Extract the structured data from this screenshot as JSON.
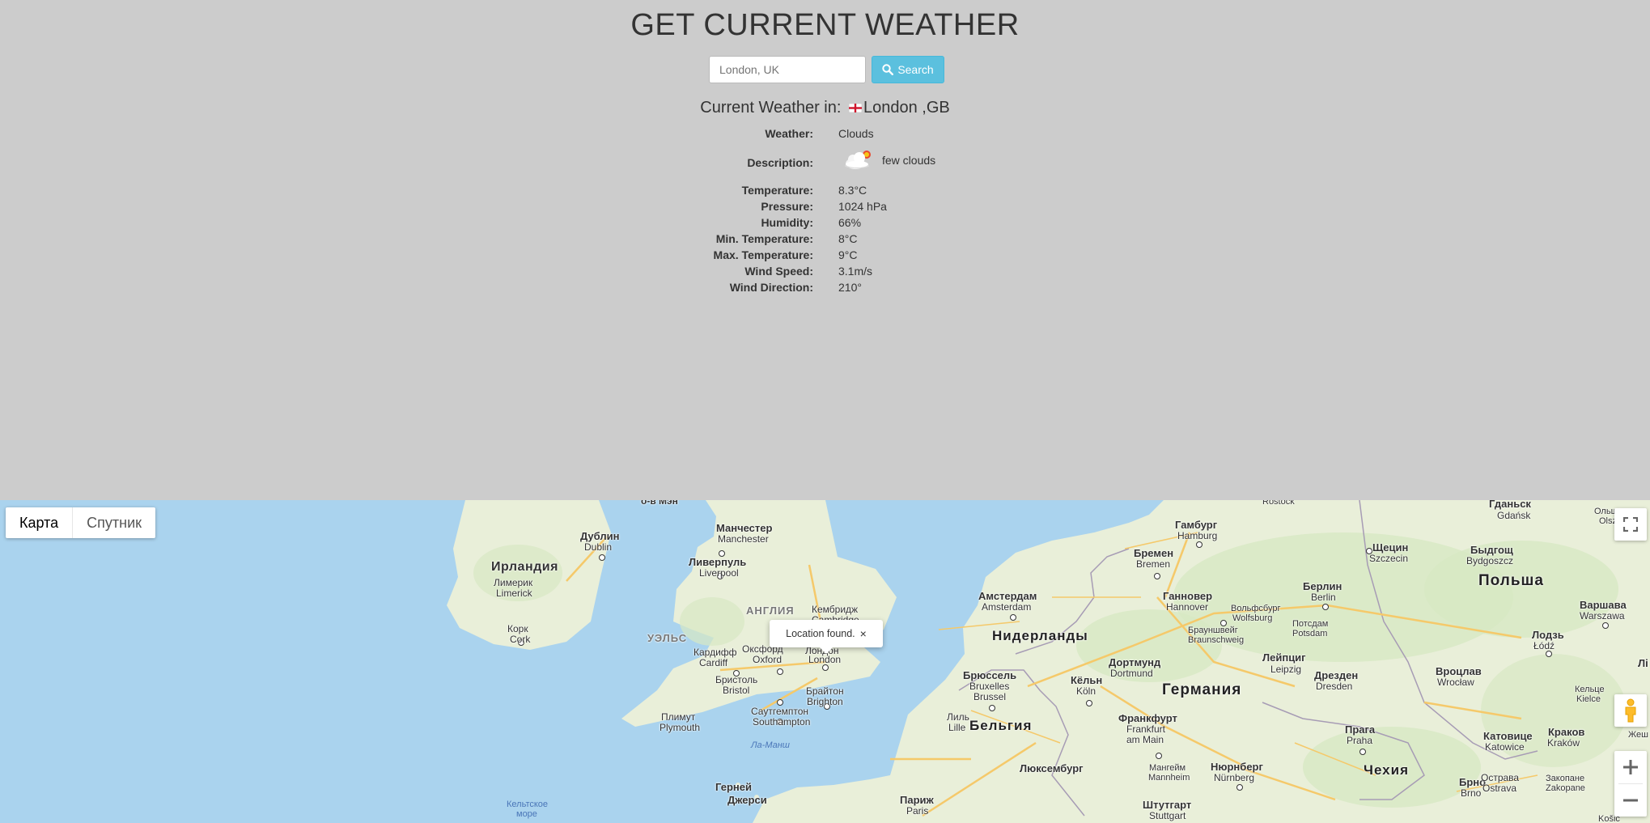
{
  "page": {
    "title": "GET CURRENT WEATHER",
    "search": {
      "placeholder": "London, UK",
      "value": "",
      "button_label": "Search"
    },
    "current": {
      "prefix": "Current Weather in:",
      "location": "London ,GB"
    },
    "weather": {
      "weather_label": "Weather:",
      "weather_value": "Clouds",
      "description_label": "Description:",
      "description_value": "few clouds",
      "temperature_label": "Temperature:",
      "temperature_value": "8.3°C",
      "pressure_label": "Pressure:",
      "pressure_value": "1024 hPa",
      "humidity_label": "Humidity:",
      "humidity_value": "66%",
      "min_temp_label": "Min. Temperature:",
      "min_temp_value": "8°C",
      "max_temp_label": "Max. Temperature:",
      "max_temp_value": "9°C",
      "wind_speed_label": "Wind Speed:",
      "wind_speed_value": "3.1m/s",
      "wind_dir_label": "Wind Direction:",
      "wind_dir_value": "210°"
    }
  },
  "map": {
    "map_type": {
      "map_label": "Карта",
      "satellite_label": "Спутник",
      "selected": "Карта"
    },
    "popup": {
      "text": "Location found.",
      "close": "×"
    },
    "labels": {
      "isle_man": "о-в Мэн",
      "manchester_ru": "Манчестер",
      "manchester": "Manchester",
      "dublin_ru": "Дублин",
      "dublin": "Dublin",
      "liverpool_ru": "Ливерпуль",
      "liverpool": "Liverpool",
      "ireland": "Ирландия",
      "limerick_ru": "Лимерик",
      "limerick": "Limerick",
      "cork_ru": "Корк",
      "cork": "Cork",
      "england": "АНГЛИЯ",
      "cambridge_ru": "Кембридж",
      "cambridge": "Cambridge",
      "wales": "УЭЛЬС",
      "cardiff_ru": "Кардифф",
      "cardiff": "Cardiff",
      "oxford_ru": "Оксфорд",
      "oxford": "Oxford",
      "london_ru": "Лондон",
      "london": "London",
      "bristol_ru": "Бристоль",
      "bristol": "Bristol",
      "brighton_ru": "Брайтон",
      "brighton": "Brighton",
      "plymouth_ru": "Плимут",
      "plymouth": "Plymouth",
      "southampton_ru": "Саутгемптон",
      "southampton": "Southampton",
      "la_manche": "Ла-Манш",
      "celtic_sea_1": "Кельтское",
      "celtic_sea_2": "море",
      "guernsey_ru": "Герней",
      "jersey_ru": "Джерси",
      "rostock": "Rostock",
      "hamburg_ru": "Гамбург",
      "hamburg": "Hamburg",
      "bremen_ru": "Бремен",
      "bremen": "Bremen",
      "amsterdam_ru": "Амстердам",
      "amsterdam": "Amsterdam",
      "hannover_ru": "Ганновер",
      "hannover": "Hannover",
      "wolfsburg_ru": "Вольфсбург",
      "wolfsburg": "Wolfsburg",
      "braunschweig_ru": "Брауншвейг",
      "braunschweig": "Braunschweig",
      "berlin_ru": "Берлин",
      "berlin": "Berlin",
      "potsdam_ru": "Потсдам",
      "potsdam": "Potsdam",
      "szczecin_ru": "Щецин",
      "szczecin": "Szczecin",
      "netherlands": "Нидерланды",
      "dortmund_ru": "Дортмунд",
      "dortmund": "Dortmund",
      "leipzig_ru": "Лейпциг",
      "leipzig": "Leipzig",
      "brussels_ru": "Брюссель",
      "brussels": "Bruxelles",
      "brussels2": "Brussel",
      "cologne_ru": "Кёльн",
      "cologne": "Köln",
      "germany": "Германия",
      "dresden_ru": "Дрезден",
      "dresden": "Dresden",
      "lille_ru": "Лиль",
      "lille": "Lille",
      "belgium": "Бельгия",
      "frankfurt_ru": "Франкфурт",
      "frankfurt": "Frankfurt",
      "frankfurt2": "am Main",
      "luxembourg_ru": "Люксембург",
      "mannheim_ru": "Мангейм",
      "mannheim": "Mannheim",
      "nuremberg_ru": "Нюрнберг",
      "nuremberg": "Nürnberg",
      "stuttgart_ru": "Штутгарт",
      "stuttgart": "Stuttgart",
      "paris_ru": "Париж",
      "paris": "Paris",
      "prague_ru": "Прага",
      "prague": "Praha",
      "czechia": "Чехия",
      "brno_ru": "Брно",
      "brno": "Brno",
      "gdansk_ru": "Гданьск",
      "gdansk": "Gdańsk",
      "olsztyn_ru": "Ольштын",
      "olsztyn": "Olsztyn",
      "bydgoszcz_ru": "Быдгощ",
      "bydgoszcz": "Bydgoszcz",
      "poland": "Польша",
      "warsaw_ru": "Варшава",
      "warsaw": "Warszawa",
      "lodz_ru": "Лодзь",
      "lodz": "Łódź",
      "wroclaw_ru": "Вроцлав",
      "wroclaw": "Wrocław",
      "kielce_ru": "Кельце",
      "kielce": "Kielce",
      "katowice_ru": "Катовице",
      "katowice": "Katowice",
      "krakow_ru": "Краков",
      "krakow": "Kraków",
      "ostrava_ru": "Острава",
      "ostrava": "Ostrava",
      "zakopane_ru": "Закопане",
      "zakopane": "Zakopane",
      "lublin_partial": "Лі",
      "zhesh_partial": "Жеш",
      "kosice_partial": "Košic"
    }
  }
}
